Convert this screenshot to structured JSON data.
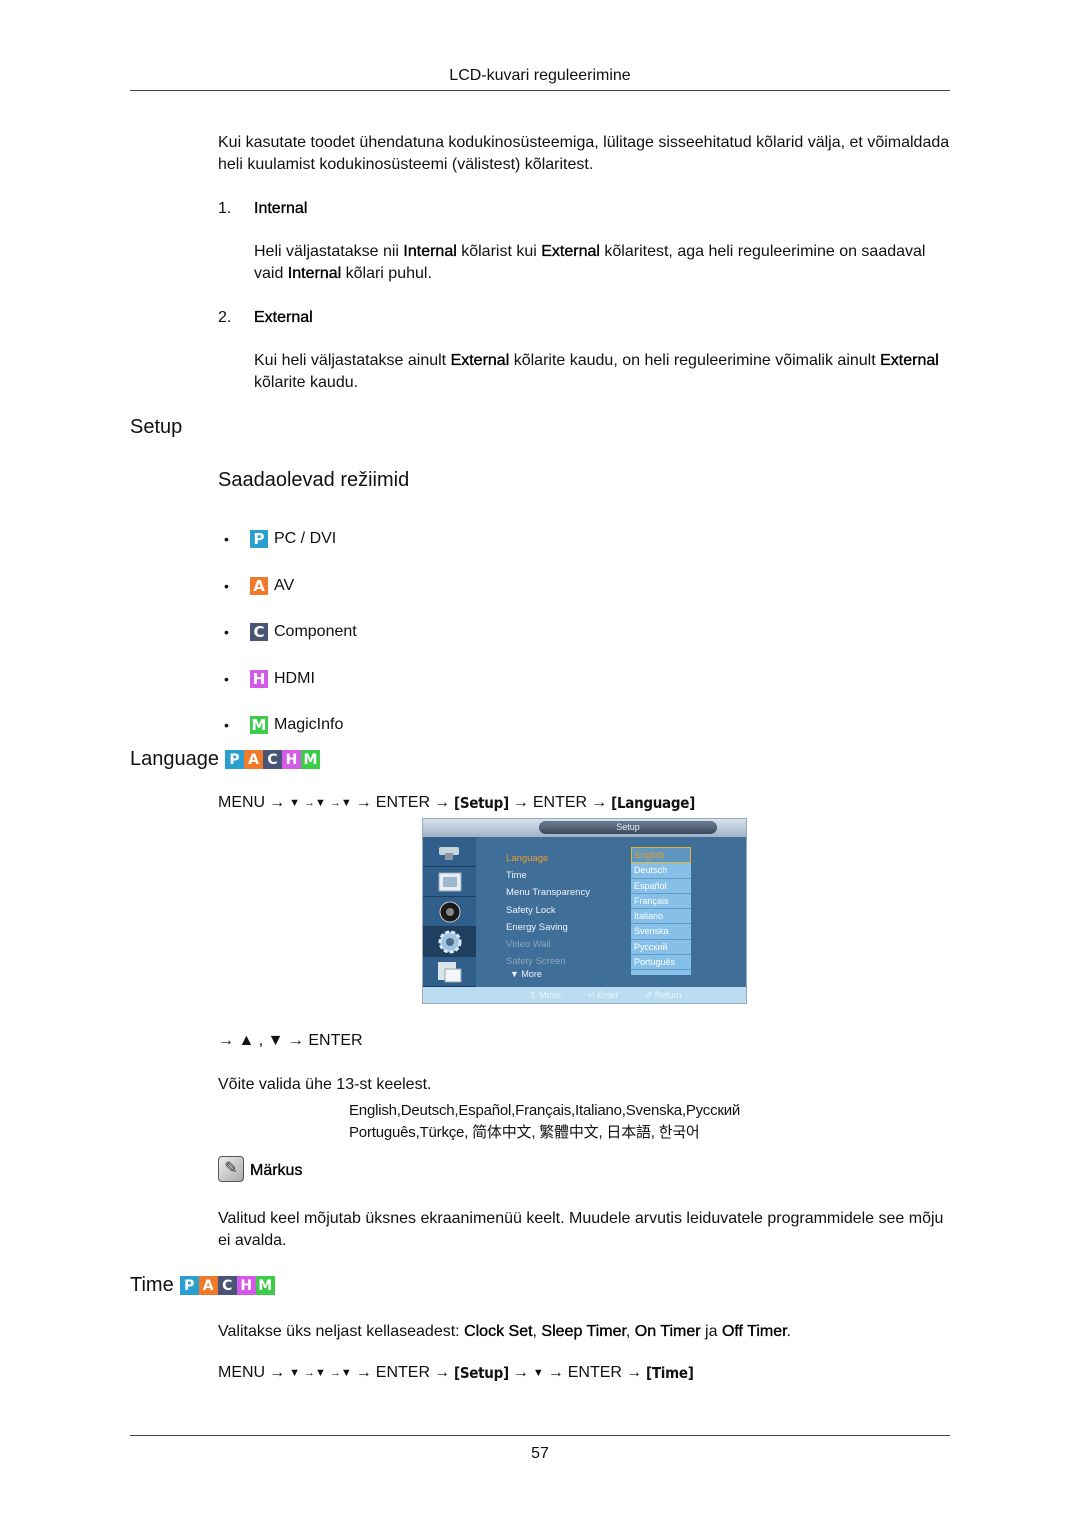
{
  "header": {
    "title": "LCD-kuvari reguleerimine"
  },
  "intro": "Kui kasutate toodet ühendatuna kodukinosüsteemiga, lülitage sisseehitatud kõlarid välja, et võimaldada heli kuulamist kodukinosüsteemi (välistest) kõlaritest.",
  "options": [
    {
      "number": "1.",
      "title": "Internal",
      "desc_parts": [
        "Heli väljastatakse nii ",
        "Internal",
        " kõlarist kui ",
        "External",
        " kõlaritest, aga heli reguleerimine on saadaval vaid ",
        "Internal",
        " kõlari puhul."
      ]
    },
    {
      "number": "2.",
      "title": "External",
      "desc_parts": [
        "Kui heli väljastatakse ainult ",
        "External",
        " kõlarite kaudu, on heli reguleerimine võimalik ainult ",
        "External",
        " kõlarite kaudu."
      ]
    }
  ],
  "setup": {
    "heading": "Setup",
    "subheading": "Saadaolevad režiimid",
    "modes": [
      {
        "letter": "P",
        "label": "PC / DVI",
        "color": "#2a9fd0",
        "icon": "pc-dvi-mode-icon"
      },
      {
        "letter": "A",
        "label": "AV",
        "color": "#f07a2a",
        "icon": "av-mode-icon"
      },
      {
        "letter": "C",
        "label": "Component",
        "color": "#4a5474",
        "icon": "component-mode-icon"
      },
      {
        "letter": "H",
        "label": "HDMI",
        "color": "#d45ae8",
        "icon": "hdmi-mode-icon"
      },
      {
        "letter": "M",
        "label": "MagicInfo",
        "color": "#3ccc4a",
        "icon": "magicinfo-mode-icon"
      }
    ]
  },
  "language": {
    "heading": "Language",
    "path": [
      "MENU",
      "→",
      "▼",
      "→▼",
      "→▼",
      "→",
      "ENTER",
      "→",
      "[Setup]",
      "→",
      "ENTER",
      "→",
      "[Language]"
    ],
    "osd": {
      "title": "Setup",
      "items": [
        "Language",
        "Time",
        "Menu Transparency",
        "Safety Lock",
        "Energy Saving",
        "Video Wall",
        "Safety Screen"
      ],
      "more": "▼ More",
      "languages": [
        "English",
        "Deutsch",
        "Español",
        "Français",
        "Italiano",
        "Svenska",
        "Русский",
        "Português"
      ],
      "selected_language": "English",
      "footer": [
        "⇕ Move",
        "⏎ Enter",
        "↺ Return"
      ]
    },
    "nav_step": "→ ▲ , ▼ → ENTER",
    "choose_text": "Võite valida ühe 13-st keelest.",
    "lang_line1": "English,Deutsch,Español,Français,Italiano,Svenska,Русский",
    "lang_line2": "Português,Türkçe, 简体中文,  繁體中文, 日本語, 한국어",
    "note_label": "Märkus",
    "note_text": "Valitud keel mõjutab üksnes ekraanimenüü keelt. Muudele arvutis leiduvatele programmidele see mõju ei avalda."
  },
  "time": {
    "heading": "Time",
    "desc_parts": [
      "Valitakse üks neljast kellaseadest: ",
      "Clock Set",
      ", ",
      "Sleep Timer",
      ", ",
      "On Timer",
      " ja ",
      "Off Timer",
      "."
    ],
    "path": [
      "MENU",
      "→",
      "▼",
      "→▼",
      "→▼",
      "→",
      "ENTER",
      "→",
      "[Setup]",
      "→",
      "▼",
      "→",
      "ENTER",
      "→",
      "[Time]"
    ]
  },
  "pachm": [
    {
      "letter": "P",
      "color": "#2a9fd0"
    },
    {
      "letter": "A",
      "color": "#f07a2a"
    },
    {
      "letter": "C",
      "color": "#4a5474"
    },
    {
      "letter": "H",
      "color": "#d45ae8"
    },
    {
      "letter": "M",
      "color": "#3ccc4a"
    }
  ],
  "footer": {
    "page_number": "57"
  }
}
